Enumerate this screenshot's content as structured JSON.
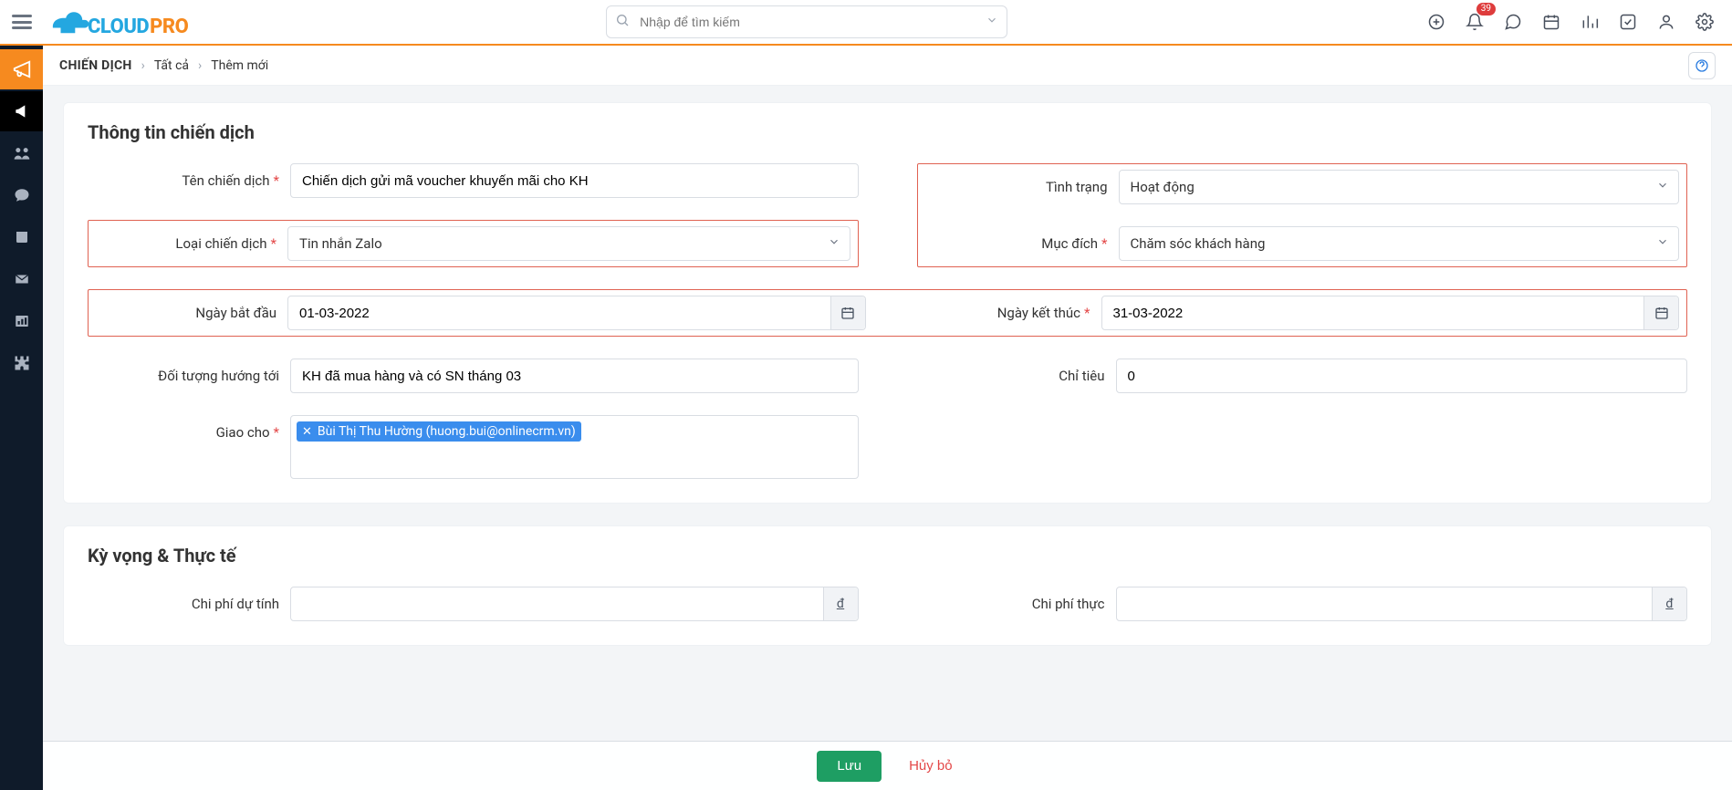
{
  "header": {
    "search_placeholder": "Nhập để tìm kiếm",
    "notification_count": "39"
  },
  "breadcrumb": {
    "title": "CHIẾN DỊCH",
    "link": "Tất cả",
    "current": "Thêm mới"
  },
  "section1": {
    "title": "Thông tin chiến dịch",
    "name_label": "Tên chiến dịch",
    "name_value": "Chiến dịch gửi mã voucher khuyến mãi cho KH",
    "type_label": "Loại chiến dịch",
    "type_value": "Tin nhắn Zalo",
    "status_label": "Tình trạng",
    "status_value": "Hoạt động",
    "purpose_label": "Mục đích",
    "purpose_value": "Chăm sóc khách hàng",
    "start_label": "Ngày bắt đầu",
    "start_value": "01-03-2022",
    "end_label": "Ngày kết thúc",
    "end_value": "31-03-2022",
    "target_label": "Đối tượng hướng tới",
    "target_value": "KH đã mua hàng và có SN tháng 03",
    "metric_label": "Chỉ tiêu",
    "metric_value": "0",
    "assign_label": "Giao cho",
    "assign_tag": "Bùi Thị Thu Hường (huong.bui@onlinecrm.vn)"
  },
  "section2": {
    "title": "Kỳ vọng & Thực tế",
    "est_label": "Chi phí dự tính",
    "act_label": "Chi phí thực",
    "currency": "đ"
  },
  "footer": {
    "save": "Lưu",
    "cancel": "Hủy bỏ"
  }
}
